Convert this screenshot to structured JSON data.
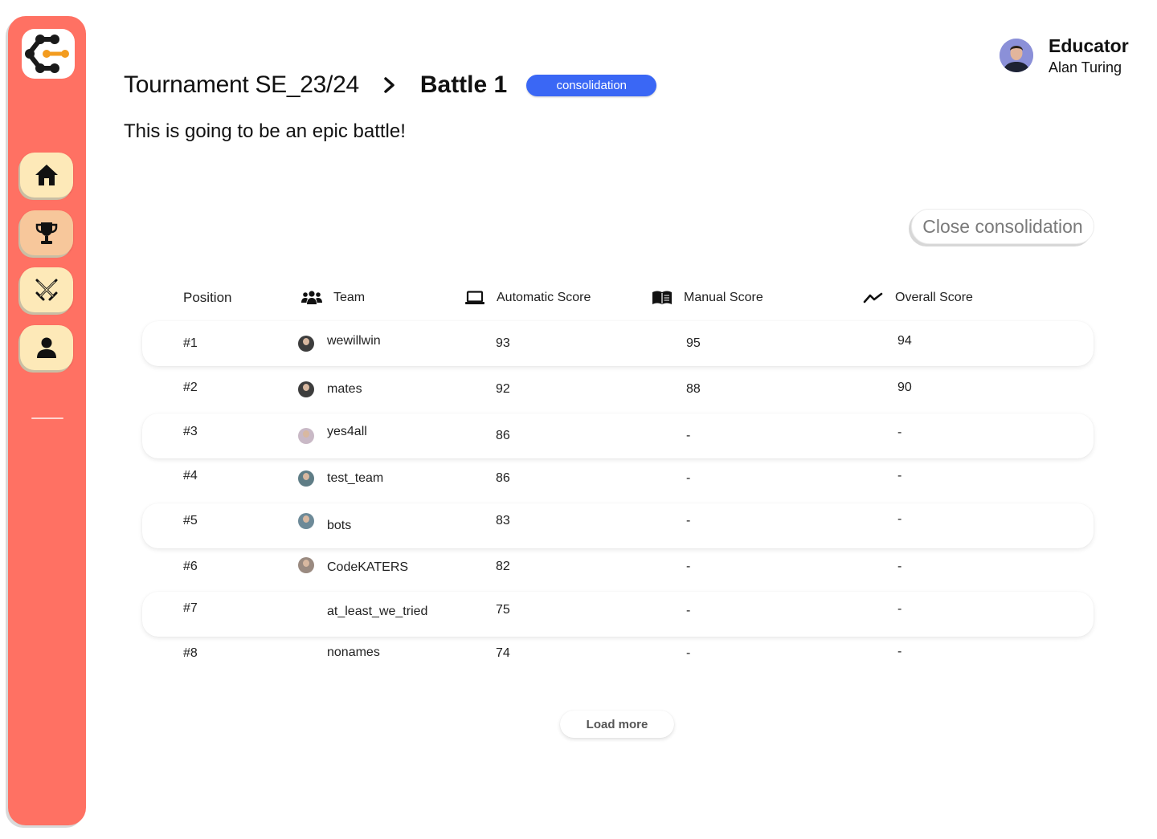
{
  "sidebar": {
    "logo_icon": "codekata-logo-icon",
    "items": [
      {
        "name": "home",
        "icon": "home-icon"
      },
      {
        "name": "tournaments",
        "icon": "trophy-icon",
        "active": true
      },
      {
        "name": "battles",
        "icon": "crossed-swords-icon"
      },
      {
        "name": "profile",
        "icon": "user-icon"
      }
    ],
    "accent": "#ff7163"
  },
  "header": {
    "tournament": "Tournament SE_23/24",
    "battle": "Battle 1",
    "phase": "consolidation",
    "description": "This is going to be an epic battle!"
  },
  "user": {
    "role": "Educator",
    "name": "Alan Turing"
  },
  "actions": {
    "close_consolidation": "Close consolidation",
    "load_more": "Load more"
  },
  "table": {
    "columns": {
      "position": "Position",
      "team": "Team",
      "automatic": "Automatic Score",
      "manual": "Manual Score",
      "overall": "Overall Score"
    },
    "rows": [
      {
        "position": "#1",
        "team": "wewillwin",
        "automatic": "93",
        "manual": "95",
        "overall": "94"
      },
      {
        "position": "#2",
        "team": "mates",
        "automatic": "92",
        "manual": "88",
        "overall": "90"
      },
      {
        "position": "#3",
        "team": "yes4all",
        "automatic": "86",
        "manual": "-",
        "overall": "-"
      },
      {
        "position": "#4",
        "team": "test_team",
        "automatic": "86",
        "manual": "-",
        "overall": "-"
      },
      {
        "position": "#5",
        "team": "bots",
        "automatic": "83",
        "manual": "-",
        "overall": "-"
      },
      {
        "position": "#6",
        "team": "CodeKATERS",
        "automatic": "82",
        "manual": "-",
        "overall": "-"
      },
      {
        "position": "#7",
        "team": "at_least_we_tried",
        "automatic": "75",
        "manual": "-",
        "overall": "-"
      },
      {
        "position": "#8",
        "team": "nonames",
        "automatic": "74",
        "manual": "-",
        "overall": "-"
      }
    ]
  },
  "colors": {
    "badge": "#3a67f5",
    "nav_button": "#fde9b8"
  }
}
